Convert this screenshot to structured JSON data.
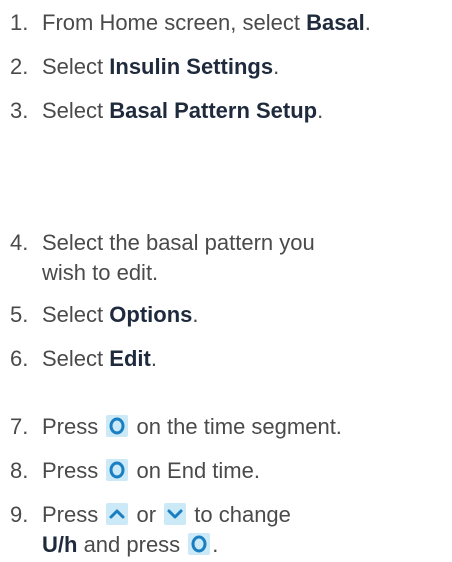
{
  "steps": [
    {
      "num": "1.",
      "pre": "From Home screen, select ",
      "bold": "Basal",
      "post": "."
    },
    {
      "num": "2.",
      "pre": "Select ",
      "bold": "Insulin Settings",
      "post": "."
    },
    {
      "num": "3.",
      "pre": "Select ",
      "bold": "Basal Pattern Setup",
      "post": "."
    },
    {
      "num": "4.",
      "line1": "Select the basal pattern you",
      "line2": "wish to edit."
    },
    {
      "num": "5.",
      "pre": "Select ",
      "bold": "Options",
      "post": "."
    },
    {
      "num": "6.",
      "pre": "Select ",
      "bold": "Edit",
      "post": "."
    },
    {
      "num": "7.",
      "pre": "Press ",
      "post": " on the time segment."
    },
    {
      "num": "8.",
      "pre": "Press ",
      "post": " on End time."
    },
    {
      "num": "9.",
      "pre": "Press ",
      "mid": " or ",
      "post": " to change",
      "bold2": "U/h",
      "post2": " and press ",
      "end": "."
    }
  ],
  "icons": {
    "select": "select-button-icon",
    "up": "up-arrow-icon",
    "down": "down-arrow-icon",
    "accent": "#1a7fc1",
    "background": "#cce9f7"
  }
}
